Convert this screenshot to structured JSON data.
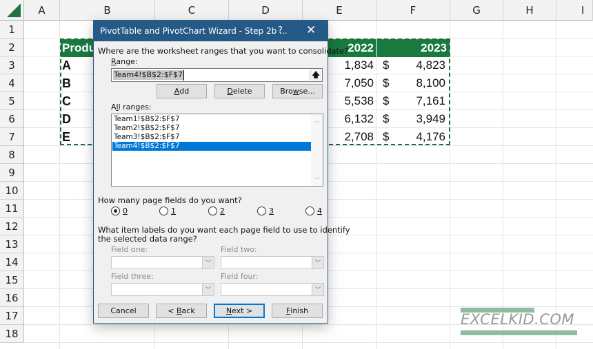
{
  "spreadsheet": {
    "columns": [
      "A",
      "B",
      "C",
      "D",
      "E",
      "F",
      "G",
      "H",
      "I"
    ],
    "rows": [
      "1",
      "2",
      "3",
      "4",
      "5",
      "6",
      "7",
      "8",
      "9",
      "10",
      "11",
      "12",
      "13",
      "14",
      "15",
      "16",
      "17",
      "18"
    ],
    "table": {
      "header": {
        "product": "Produ",
        "y2022": "2022",
        "y2023": "2023"
      },
      "rows": [
        {
          "product": "A",
          "v2022": "1,834",
          "currency": "$",
          "v2023": "4,823"
        },
        {
          "product": "B",
          "v2022": "7,050",
          "currency": "$",
          "v2023": "8,100"
        },
        {
          "product": "C",
          "v2022": "5,538",
          "currency": "$",
          "v2023": "7,161"
        },
        {
          "product": "D",
          "v2022": "6,132",
          "currency": "$",
          "v2023": "3,949"
        },
        {
          "product": "E",
          "v2022": "2,708",
          "currency": "$",
          "v2023": "4,176"
        }
      ]
    },
    "header_color": "#187a3f"
  },
  "dialog": {
    "title": "PivotTable and PivotChart Wizard - Step 2b ...",
    "help_label": "?",
    "close_label": "✕",
    "question": "Where are the worksheet ranges that you want to consolidate?",
    "range_label_u": "R",
    "range_label_rest": "ange:",
    "range_value": "Team4!$B$2:$F$7",
    "collapse_icon": "🡅",
    "buttons": {
      "add_u": "A",
      "add_rest": "dd",
      "delete_u": "D",
      "delete_rest": "elete",
      "browse_pre": "Bro",
      "browse_u": "w",
      "browse_rest": "se..."
    },
    "all_ranges_pre": "A",
    "all_ranges_u": "l",
    "all_ranges_rest": "l ranges:",
    "all_ranges": [
      "Team1!$B$2:$F$7",
      "Team2!$B$2:$F$7",
      "Team3!$B$2:$F$7",
      "Team4!$B$2:$F$7"
    ],
    "selected_range_index": 3,
    "page_fields_question": "How many page fields do you want?",
    "page_field_options": [
      "0",
      "1",
      "2",
      "3",
      "4"
    ],
    "page_fields_selected": "0",
    "item_labels_question_1": "What item labels do you want each page field to use to identify",
    "item_labels_question_2": "the selected data range?",
    "fields": {
      "one": "Field one:",
      "two": "Field two:",
      "three": "Field three:",
      "four": "Field four:"
    },
    "footer": {
      "cancel": "Cancel",
      "back_pre": "< ",
      "back_u": "B",
      "back_rest": "ack",
      "next_u": "N",
      "next_rest": "ext >",
      "finish_u": "F",
      "finish_rest": "inish"
    },
    "accent": "#0078d7",
    "title_color": "#255a86"
  },
  "watermark": {
    "text": "EXCELKID.COM"
  }
}
